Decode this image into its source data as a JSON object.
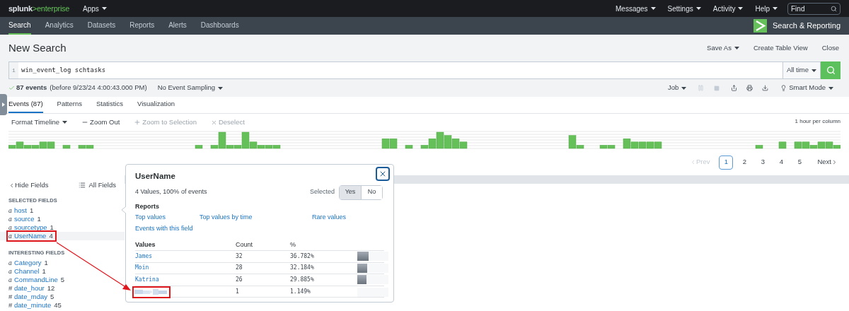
{
  "logo": {
    "prefix": "splunk",
    "suffix": ">enterprise"
  },
  "top_menu": {
    "apps": "Apps",
    "items": [
      "Messages",
      "Settings",
      "Activity",
      "Help"
    ],
    "find": {
      "placeholder": "Find"
    }
  },
  "nav": {
    "tabs": [
      {
        "label": "Search",
        "selected": true
      },
      {
        "label": "Analytics",
        "selected": false
      },
      {
        "label": "Datasets",
        "selected": false
      },
      {
        "label": "Reports",
        "selected": false
      },
      {
        "label": "Alerts",
        "selected": false
      },
      {
        "label": "Dashboards",
        "selected": false
      }
    ],
    "app_title": "Search & Reporting"
  },
  "page": {
    "title": "New Search",
    "actions": [
      {
        "label": "Save As",
        "dropdown": true
      },
      {
        "label": "Create Table View",
        "dropdown": false
      },
      {
        "label": "Close",
        "dropdown": false
      }
    ]
  },
  "search": {
    "line_number": "1",
    "query": "win_event_log schtasks",
    "time_range": "All time"
  },
  "status": {
    "count": "87 events",
    "detail": "(before 9/23/24 4:00:43.000 PM)",
    "sampling": "No Event Sampling",
    "job": "Job",
    "mode": "Smart Mode"
  },
  "result_tabs": [
    {
      "label": "Events (87)",
      "selected": true
    },
    {
      "label": "Patterns",
      "selected": false
    },
    {
      "label": "Statistics",
      "selected": false
    },
    {
      "label": "Visualization",
      "selected": false
    }
  ],
  "timeline": {
    "controls": [
      {
        "kind": "menu",
        "label": "Format Timeline",
        "disabled": false
      },
      {
        "kind": "minus",
        "label": "Zoom Out",
        "disabled": false
      },
      {
        "kind": "plus",
        "label": "Zoom to Selection",
        "disabled": true
      },
      {
        "kind": "times",
        "label": "Deselect",
        "disabled": true
      }
    ],
    "scale": "1 hour per column"
  },
  "pagination": {
    "prev": {
      "label": "Prev",
      "disabled": true
    },
    "pages": [
      {
        "label": "1",
        "selected": true
      },
      {
        "label": "2",
        "selected": false
      },
      {
        "label": "3",
        "selected": false
      },
      {
        "label": "4",
        "selected": false
      },
      {
        "label": "5",
        "selected": false
      }
    ],
    "next": {
      "label": "Next",
      "disabled": false
    }
  },
  "fields": {
    "hide": "Hide Fields",
    "all": "All Fields",
    "sections": [
      {
        "title": "SELECTED FIELDS",
        "items": [
          {
            "type": "a",
            "name": "host",
            "count": "1",
            "selected": false
          },
          {
            "type": "a",
            "name": "source",
            "count": "1",
            "selected": false
          },
          {
            "type": "a",
            "name": "sourcetype",
            "count": "1",
            "selected": false
          },
          {
            "type": "a",
            "name": "UserName",
            "count": "4",
            "selected": true
          }
        ]
      },
      {
        "title": "INTERESTING FIELDS",
        "items": [
          {
            "type": "a",
            "name": "Category",
            "count": "1",
            "selected": false
          },
          {
            "type": "a",
            "name": "Channel",
            "count": "1",
            "selected": false
          },
          {
            "type": "a",
            "name": "CommandLine",
            "count": "5",
            "selected": false
          },
          {
            "type": "#",
            "name": "date_hour",
            "count": "12",
            "selected": false
          },
          {
            "type": "#",
            "name": "date_mday",
            "count": "5",
            "selected": false
          },
          {
            "type": "#",
            "name": "date_minute",
            "count": "45",
            "selected": false
          }
        ]
      }
    ]
  },
  "popup": {
    "title": "UserName",
    "summary": "4 Values, 100% of events",
    "selected_label": "Selected",
    "toggle": [
      {
        "label": "Yes",
        "selected": true
      },
      {
        "label": "No",
        "selected": false
      }
    ],
    "reports_title": "Reports",
    "reports": [
      "Top values",
      "Top values by time",
      "Rare values",
      "Events with this field"
    ],
    "columns": [
      "Values",
      "Count",
      "%"
    ],
    "rows": [
      {
        "kind": "value",
        "value": "James",
        "count": "32",
        "percent": "36.782%",
        "level": 0.368
      },
      {
        "kind": "value",
        "value": "Moin",
        "count": "28",
        "percent": "32.184%",
        "level": 0.322
      },
      {
        "kind": "value",
        "value": "Katrina",
        "count": "26",
        "percent": "29.885%",
        "level": 0.299
      },
      {
        "kind": "redacted",
        "count": "1",
        "percent": "1.149%"
      }
    ]
  },
  "annotation": {
    "kind": "arrow-callout"
  }
}
